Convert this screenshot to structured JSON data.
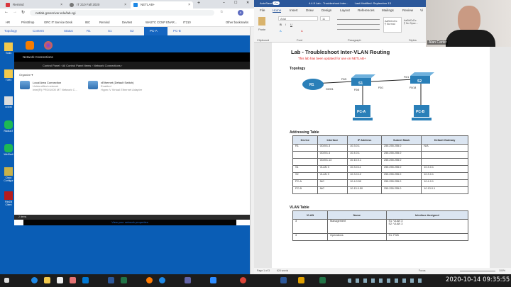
{
  "browser": {
    "tabs": [
      {
        "label": "Remind",
        "color": "#d9363e"
      },
      {
        "label": "IT 210 Fall 2020",
        "color": "#666"
      },
      {
        "label": "NETLAB+",
        "color": "#1e88e5"
      }
    ],
    "url": "netlab.greenriver.edu/lab.cgi",
    "bookmarks": [
      "HR",
      "PrintShop",
      "GRC IT Service Desk",
      "IBC",
      "Remind",
      "DevNet",
      "WASTC CCNP ENAR...",
      "IT210"
    ],
    "other_bookmarks": "Other bookmarks",
    "profile_initial": "A",
    "netlab_toolbar": [
      "Topology",
      "Content",
      "Status",
      "R1",
      "S1",
      "S2",
      "PC-A",
      "PC-B"
    ],
    "netlab_active": "PC-A"
  },
  "desktop": {
    "icons": [
      "Tools",
      "",
      "T3H0",
      "cctvat",
      "RadiusT",
      "WinRadi",
      "Cisco Configur",
      "FileZill Client"
    ]
  },
  "network_window": {
    "title": "Network Connections",
    "breadcrumb": [
      "Control Panel",
      "All Control Panel Items",
      "Network Connections"
    ],
    "organize": "Organize ▾",
    "connections": [
      {
        "name": "Local Area Connection",
        "status": "Unidentified network",
        "adapter": "Intel(R) PRO/1000 MT Network C..."
      },
      {
        "name": "vEthernet (Default Switch)",
        "status": "Enabled",
        "adapter": "Hyper-V Virtual Ethernet Adapter"
      }
    ],
    "status_bar": "2 items",
    "bottom_link": "View your network properties"
  },
  "word": {
    "autosave": "AutoSave",
    "autosave_state": "On",
    "doc_title": "4.4.5 Lab - Troubleshoot Inter...",
    "last_modified": "Last Modified: September 13",
    "tabs": [
      "File",
      "Home",
      "Insert",
      "Draw",
      "Design",
      "Layout",
      "References",
      "Mailings",
      "Review",
      "Vi"
    ],
    "active_tab": "Home",
    "font": "Arial",
    "font_size": "11",
    "styles": [
      "AaBbCcDc",
      "AaBbCcDc"
    ],
    "style_names": [
      "¶ Normal",
      "¶ No Spac..."
    ],
    "groups": [
      "Clipboard",
      "Font",
      "Paragraph",
      "Styles"
    ],
    "paste": "Paste",
    "status": {
      "page": "Page 1 of 3",
      "words": "624 words",
      "focus": "Focus",
      "zoom": "100%"
    }
  },
  "document": {
    "title": "Lab - Troubleshoot Inter-VLAN Routing",
    "subtitle": "This lab has been updated for use on NETLAB+",
    "topology_heading": "Topology",
    "topology": {
      "devices": [
        "R1",
        "S1",
        "S2",
        "PC-A",
        "PC-B"
      ],
      "labels": [
        "G0/0/1",
        "F0/5",
        "F0/6",
        "F0/1",
        "F0/1",
        "F0/18"
      ]
    },
    "addressing_heading": "Addressing Table",
    "addressing_headers": [
      "Device",
      "Interface",
      "IP Address",
      "Subnet Mask",
      "Default Gateway"
    ],
    "addressing_rows": [
      [
        "R1",
        "G0/0/1.3",
        "10.3.0.1",
        "255.255.255.0",
        "N/A"
      ],
      [
        "",
        "G0/0/1.4",
        "10.4.0.1",
        "255.255.255.0",
        ""
      ],
      [
        "",
        "G0/0/1.13",
        "10.13.0.1",
        "255.255.255.0",
        ""
      ],
      [
        "S1",
        "VLAN 3",
        "10.3.0.11",
        "255.255.255.0",
        "10.3.0.1"
      ],
      [
        "S2",
        "VLAN 3",
        "10.3.0.12",
        "255.255.255.0",
        "10.3.0.1"
      ],
      [
        "PC-A",
        "NIC",
        "10.4.0.50",
        "255.255.255.0",
        "10.4.0.1"
      ],
      [
        "PC-B",
        "NIC",
        "10.13.0.50",
        "255.255.255.0",
        "10.13.0.1"
      ]
    ],
    "vlan_heading": "VLAN Table",
    "vlan_headers": [
      "VLAN",
      "Name",
      "Interface Assigned"
    ],
    "vlan_rows": [
      [
        "3",
        "Management",
        "S1: VLAN 3\nS2: VLAN 3"
      ],
      [
        "4",
        "Operations",
        "S1: F0/6"
      ]
    ]
  },
  "webcam": {
    "name": "Alan Carter"
  },
  "taskbar": {
    "clock": "2020-10-14 09:35:55"
  }
}
